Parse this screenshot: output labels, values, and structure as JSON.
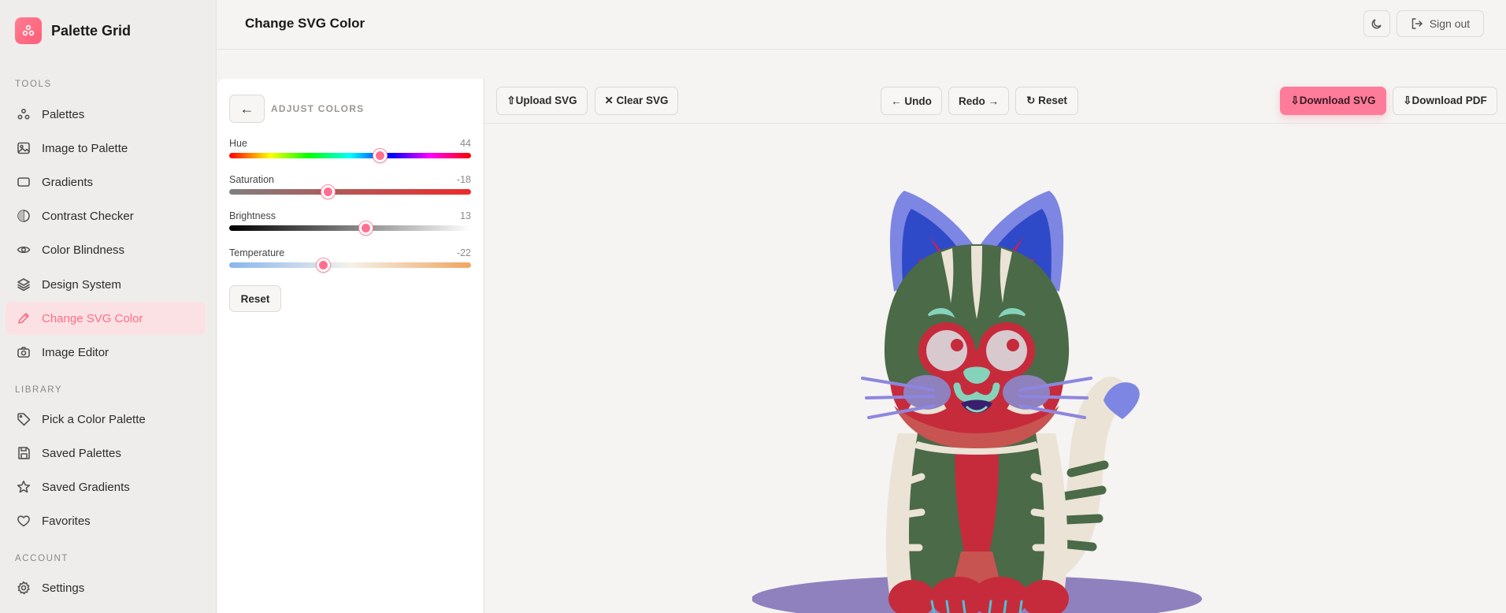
{
  "brand": {
    "name": "Palette Grid"
  },
  "sidebar": {
    "sections": {
      "tools": "TOOLS",
      "library": "LIBRARY",
      "account": "ACCOUNT"
    },
    "tools": [
      {
        "label": "Palettes",
        "icon": "palette-icon"
      },
      {
        "label": "Image to Palette",
        "icon": "image-icon"
      },
      {
        "label": "Gradients",
        "icon": "gradient-icon"
      },
      {
        "label": "Contrast Checker",
        "icon": "contrast-icon"
      },
      {
        "label": "Color Blindness",
        "icon": "eye-icon"
      },
      {
        "label": "Design System",
        "icon": "layers-icon"
      },
      {
        "label": "Change SVG Color",
        "icon": "pen-icon",
        "active": true
      },
      {
        "label": "Image Editor",
        "icon": "camera-icon"
      }
    ],
    "library": [
      {
        "label": "Pick a Color Palette",
        "icon": "tag-icon"
      },
      {
        "label": "Saved Palettes",
        "icon": "save-icon"
      },
      {
        "label": "Saved Gradients",
        "icon": "star-icon"
      },
      {
        "label": "Favorites",
        "icon": "heart-icon"
      }
    ],
    "account": [
      {
        "label": "Settings",
        "icon": "gear-icon"
      }
    ]
  },
  "header": {
    "title": "Change SVG Color",
    "signout_label": "Sign out"
  },
  "panel": {
    "back_label": "←",
    "title": "ADJUST COLORS",
    "sliders": [
      {
        "label": "Hue",
        "value": "44",
        "min": -180,
        "max": 180,
        "num": 44
      },
      {
        "label": "Saturation",
        "value": "-18",
        "min": -100,
        "max": 100,
        "num": -18
      },
      {
        "label": "Brightness",
        "value": "13",
        "min": -100,
        "max": 100,
        "num": 13
      },
      {
        "label": "Temperature",
        "value": "-22",
        "min": -100,
        "max": 100,
        "num": -22
      }
    ],
    "reset_label": "Reset"
  },
  "toolbar": {
    "upload_label": "⇧Upload SVG",
    "clear_label": "✕ Clear SVG",
    "undo_label": "← Undo",
    "redo_label": "Redo →",
    "reset_label": "↻ Reset",
    "download_svg_label": "⇩Download SVG",
    "download_pdf_label": "⇩Download PDF"
  },
  "colors": {
    "accent": "#ff6f86",
    "cat_body": "#4b6a47",
    "cat_red": "#c62b3c",
    "cat_ear": "#7d86e2",
    "cat_cream": "#ebe3d6",
    "cat_shadow": "#8f80be"
  }
}
